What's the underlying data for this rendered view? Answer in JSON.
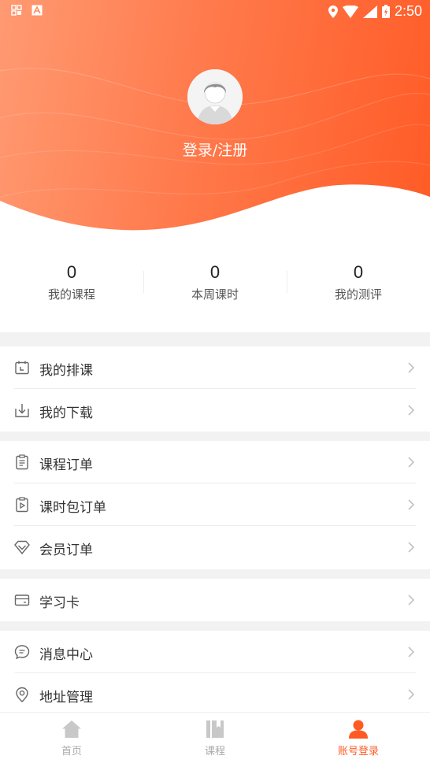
{
  "status_bar": {
    "time": "2:50"
  },
  "profile": {
    "login_label": "登录/注册"
  },
  "stats": [
    {
      "value": "0",
      "label": "我的课程"
    },
    {
      "value": "0",
      "label": "本周课时"
    },
    {
      "value": "0",
      "label": "我的测评"
    }
  ],
  "menu": {
    "schedule": "我的排课",
    "downloads": "我的下载",
    "course_orders": "课程订单",
    "package_orders": "课时包订单",
    "member_orders": "会员订单",
    "study_card": "学习卡",
    "messages": "消息中心",
    "address": "地址管理"
  },
  "tabs": [
    {
      "label": "首页",
      "icon": "home-icon"
    },
    {
      "label": "课程",
      "icon": "book-icon"
    },
    {
      "label": "账号登录",
      "icon": "user-icon",
      "active": true
    }
  ],
  "colors": {
    "accent": "#ff5a24",
    "header_start": "#ff9a72",
    "header_end": "#ff5b26",
    "inactive": "#aaaaaa"
  }
}
